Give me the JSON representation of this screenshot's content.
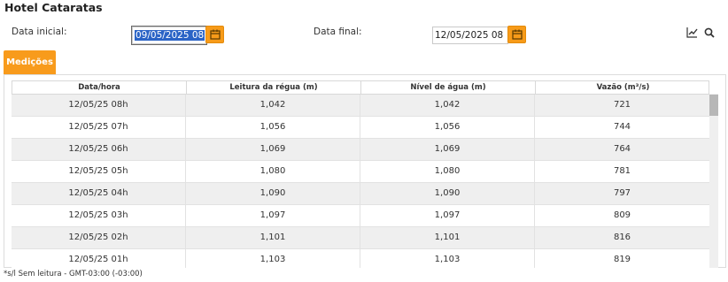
{
  "header": {
    "title": "Hotel Cataratas"
  },
  "filters": {
    "start_label": "Data inicial:",
    "start_value": "09/05/2025 08",
    "end_label": "Data final:",
    "end_value": "12/05/2025 08"
  },
  "toolbar": {
    "chart_icon": "chart-line-icon",
    "search_icon": "search-icon"
  },
  "tabs": [
    {
      "label": "Medições",
      "active": true
    }
  ],
  "table": {
    "columns": [
      "Data/hora",
      "Leitura da régua (m)",
      "Nível de água (m)",
      "Vazão (m³/s)"
    ],
    "rows": [
      [
        "12/05/25 08h",
        "1,042",
        "1,042",
        "721"
      ],
      [
        "12/05/25 07h",
        "1,056",
        "1,056",
        "744"
      ],
      [
        "12/05/25 06h",
        "1,069",
        "1,069",
        "764"
      ],
      [
        "12/05/25 05h",
        "1,080",
        "1,080",
        "781"
      ],
      [
        "12/05/25 04h",
        "1,090",
        "1,090",
        "797"
      ],
      [
        "12/05/25 03h",
        "1,097",
        "1,097",
        "809"
      ],
      [
        "12/05/25 02h",
        "1,101",
        "1,101",
        "816"
      ],
      [
        "12/05/25 01h",
        "1,103",
        "1,103",
        "819"
      ]
    ]
  },
  "footnote": "*s/l Sem leitura - GMT-03:00 (-03:00)",
  "colors": {
    "accent": "#f89b1c",
    "selection": "#2b64c6"
  }
}
